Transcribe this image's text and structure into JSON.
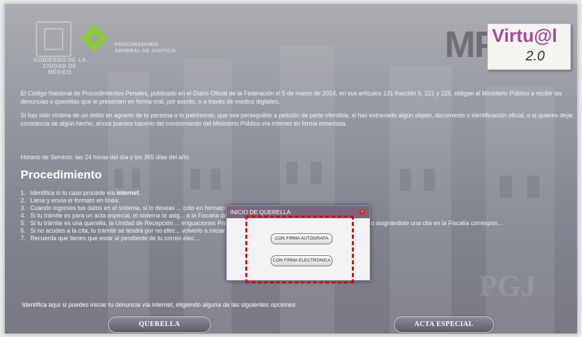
{
  "header": {
    "gov_text": "GOBIERNO DE LA CIUDAD DE MÉXICO",
    "pgj_text": "PROCURADURÍA GENERAL DE JUSTICIA",
    "mp_logo": {
      "mp": "MP",
      "virtual": "Virtu@l",
      "version": "2.0"
    }
  },
  "intro": {
    "p1": "El Código Nacional de Procedimientos Penales, publicado en el Diario Oficial de la Federación el 5 de marzo de 2014, en sus artículos 131 fracción II, 221 y 225, obligan al Ministerio Público a recibir las denuncias o querellas que le presenten en forma oral, por escrito, o a través de medios digitales.",
    "p2": "Si has sido víctima de un delito en agravio de tu persona o tu patrimonio, que sea perseguible a petición de parte ofendida; si has extraviado algún objeto, documento o identificación oficial, o si quieres dejar constancia de algún hecho, ahora puedes hacerlo del conocimiento del Ministerio Público vía internet en forma inmediata.",
    "p3": "Horario de Servicio: las 24 horas del día y los 365 días del año."
  },
  "procedure": {
    "title": "Procedimiento",
    "steps": [
      {
        "num": "1.",
        "text": "Identifica si tu caso procede vía ",
        "bold": "internet",
        "after": "."
      },
      {
        "num": "2.",
        "text": "Llena y envía el formato en línea."
      },
      {
        "num": "3.",
        "text": "Cuando ingreses tus datos en el sistema, si lo deseas ...                                                              crito en formato PDF, con tu firma e identificación oficial digitalizados."
      },
      {
        "num": "4.",
        "text": "Si tu trámite es para un acta especial, el sistema te asig...                                                            a la Fiscalía de la Delegación de tu elección."
      },
      {
        "num": "5.",
        "text": "Si tu trámite es una querella, la Unidad de Recepción ...                                                            eriguaciones Previas Desconcentradas, te enviará un correo electrónico asignándote una cita en la Fiscalía correspon..."
      },
      {
        "num": "6.",
        "text": "Si no acudes a la cita, tu trámite se tendrá por no efec...                                                            volverlo a iniciar por esta vía o en la agencia del Ministerio Público."
      },
      {
        "num": "7.",
        "text": "Recuerda que tienes que estar al pendiente de tu correo elec..."
      }
    ]
  },
  "choose_text": "Identifica aquí si puedes iniciar tu denuncia vía internet, eligiendo alguna de las siguientes opciones:",
  "buttons": {
    "querella": "QUERELLA",
    "acta": "ACTA ESPECIAL"
  },
  "dialog": {
    "title": "INICIO DE QUERELLA",
    "close": "×",
    "btn_autografa": "CON FIRMA AUTÓGRAFA",
    "btn_electronica": "CON FIRMA ELECTRÓNICA"
  },
  "colors": {
    "accent": "#7b667d",
    "highlight": "#c8101c",
    "virtual": "#a8489a"
  },
  "icons": {
    "gov_seal": "seal-icon",
    "cdmx_logo": "cdmx-logo-icon",
    "close": "close-icon"
  }
}
